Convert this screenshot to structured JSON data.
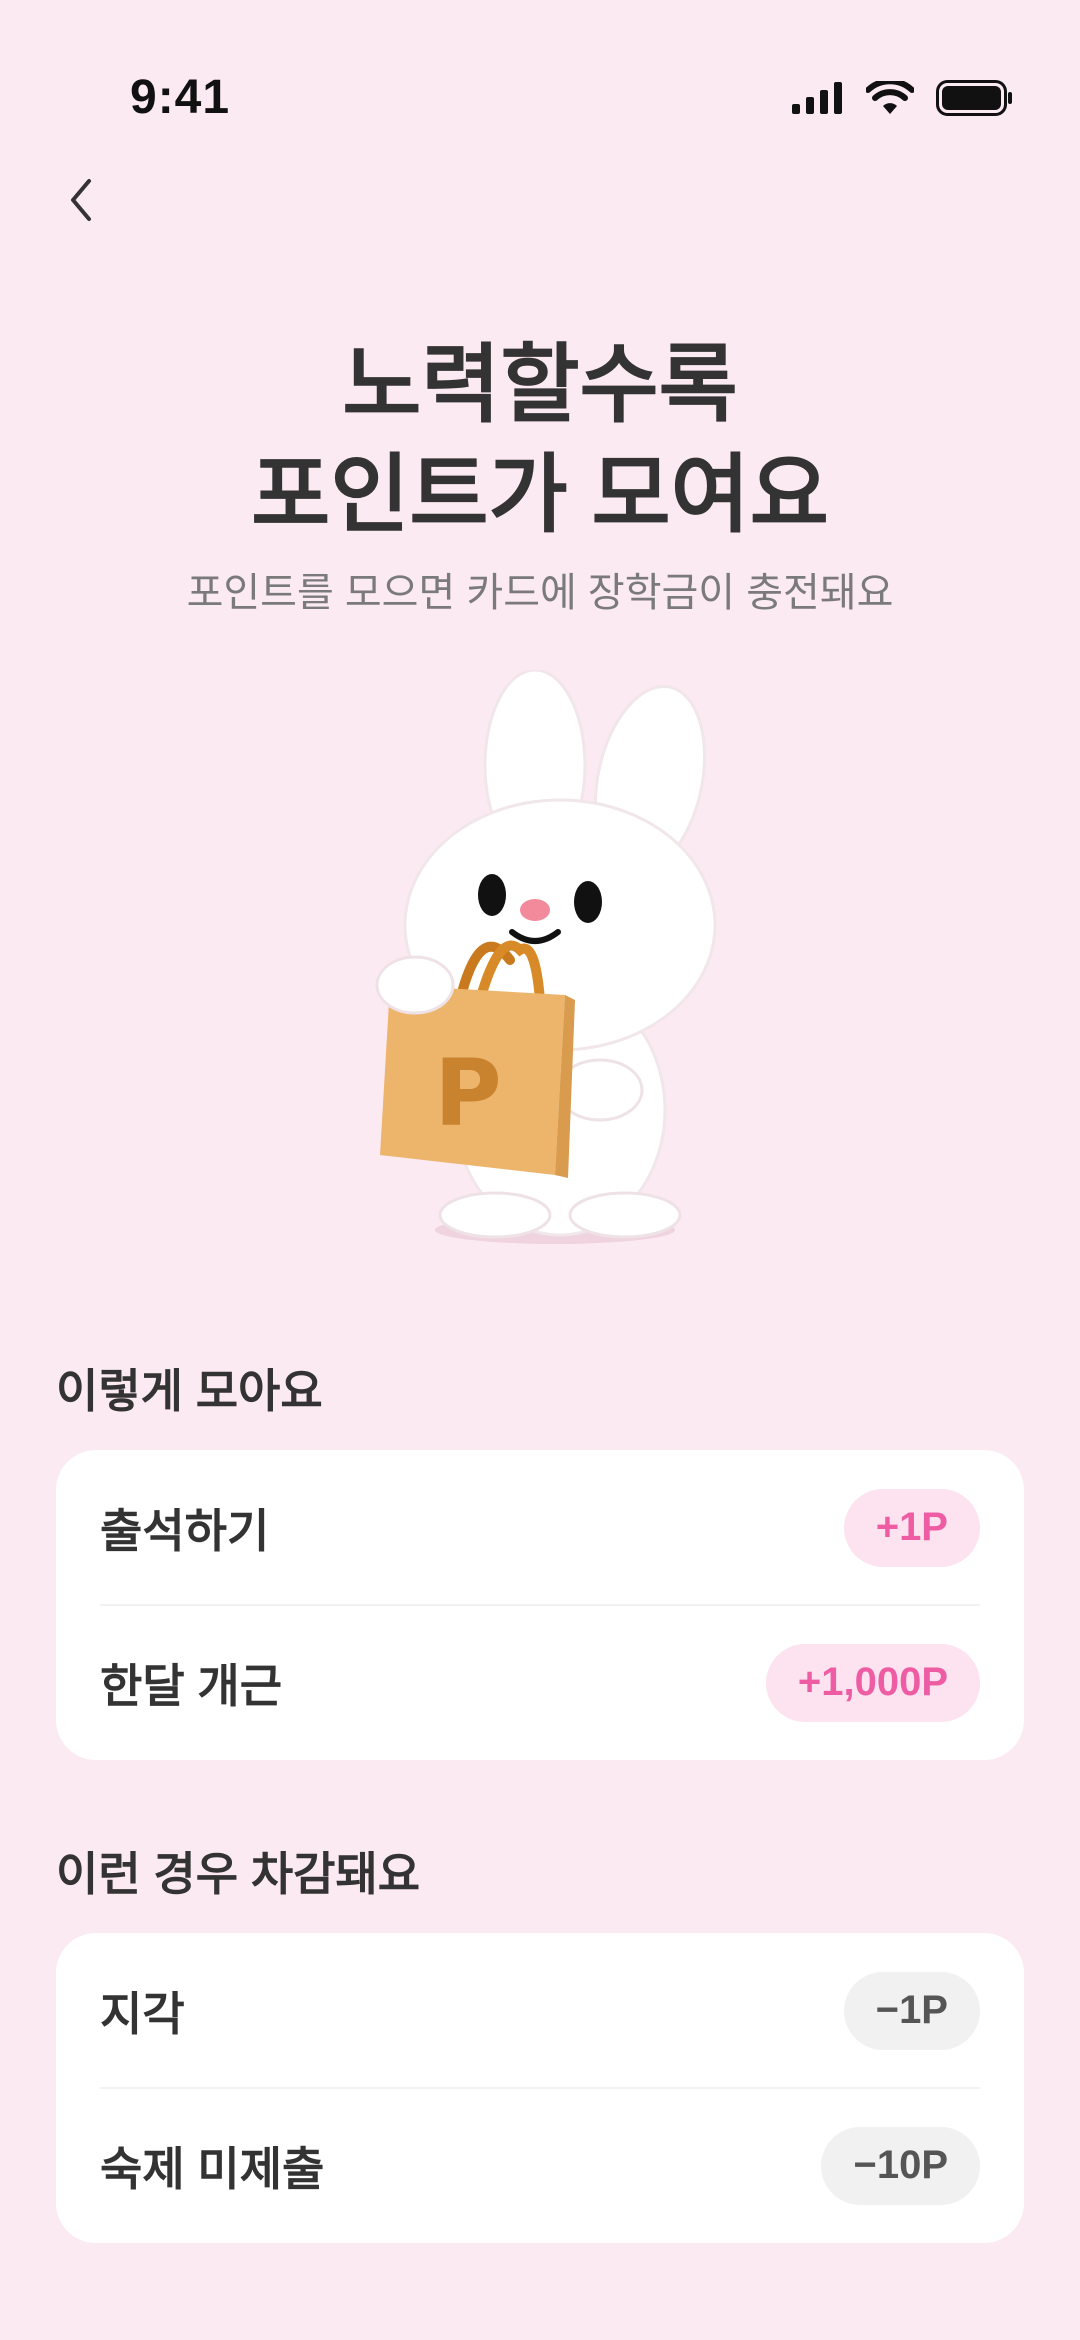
{
  "status_bar": {
    "time": "9:41"
  },
  "hero": {
    "title_line1": "노력할수록",
    "title_line2": "포인트가 모여요",
    "subtitle": "포인트를 모으면 카드에 장학금이 충전돼요"
  },
  "mascot": {
    "bag_letter": "P"
  },
  "earn": {
    "title": "이렇게 모아요",
    "items": [
      {
        "label": "출석하기",
        "points": "+1P"
      },
      {
        "label": "한달 개근",
        "points": "+1,000P"
      }
    ]
  },
  "deduct": {
    "title": "이런 경우 차감돼요",
    "items": [
      {
        "label": "지각",
        "points": "−1P"
      },
      {
        "label": "숙제 미제출",
        "points": "−10P"
      }
    ]
  },
  "colors": {
    "background": "#FCEAF2",
    "accent_pink": "#EE5DA4",
    "accent_pink_bg": "#FDE3EF",
    "neutral_pill_bg": "#F1F1F1"
  },
  "icons": [
    "back-chevron-icon",
    "cellular-signal-icon",
    "wifi-icon",
    "battery-icon"
  ]
}
